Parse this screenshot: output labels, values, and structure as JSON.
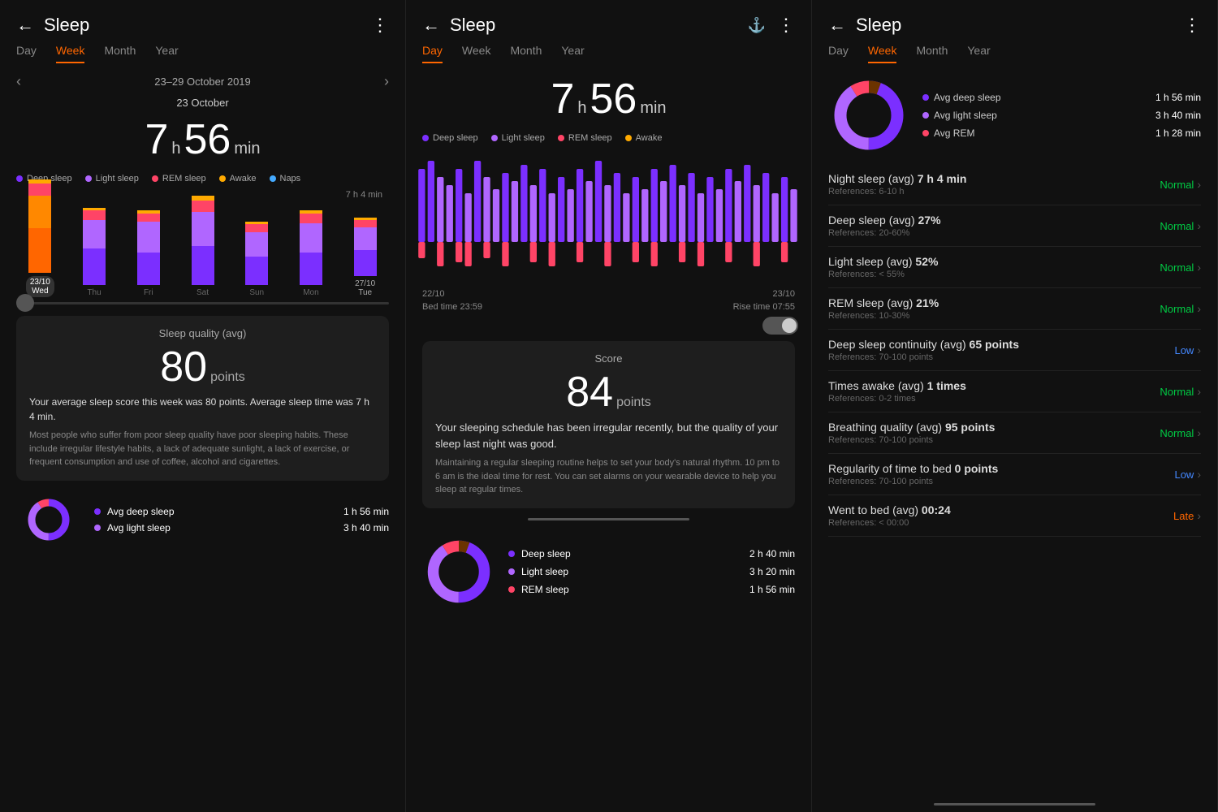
{
  "panel1": {
    "title": "Sleep",
    "tabs": [
      "Day",
      "Week",
      "Month",
      "Year"
    ],
    "active_tab": "Week",
    "nav_date": "23–29 October 2019",
    "sub_date": "23 October",
    "sleep_h": "7",
    "sleep_min": "56",
    "legend": [
      {
        "label": "Deep sleep",
        "color": "#7b2fff"
      },
      {
        "label": "Light sleep",
        "color": "#b066ff"
      },
      {
        "label": "REM sleep",
        "color": "#ff4466"
      },
      {
        "label": "Awake",
        "color": "#ffaa00"
      },
      {
        "label": "Naps",
        "color": "#44aaff"
      }
    ],
    "bar_avg_label": "7 h 4 min",
    "bars": [
      {
        "day": "23/10",
        "sub": "Wed",
        "active": true,
        "deep": 60,
        "light": 40,
        "rem": 15,
        "awake": 5
      },
      {
        "day": "Thu",
        "sub": "",
        "active": false,
        "deep": 40,
        "light": 35,
        "rem": 12,
        "awake": 3
      },
      {
        "day": "Fri",
        "sub": "",
        "active": false,
        "deep": 35,
        "light": 38,
        "rem": 10,
        "awake": 4
      },
      {
        "day": "Sat",
        "sub": "",
        "active": false,
        "deep": 45,
        "light": 42,
        "rem": 14,
        "awake": 6
      },
      {
        "day": "Sun",
        "sub": "",
        "active": false,
        "deep": 30,
        "light": 30,
        "rem": 10,
        "awake": 3
      },
      {
        "day": "Mon",
        "sub": "",
        "active": false,
        "deep": 38,
        "light": 36,
        "rem": 12,
        "awake": 4
      },
      {
        "day": "27/10",
        "sub": "Tue",
        "active": false,
        "deep": 32,
        "light": 28,
        "rem": 9,
        "awake": 3
      }
    ],
    "score_title": "Sleep quality (avg)",
    "score": "80",
    "score_pts": "points",
    "score_desc": "Your average sleep score this week was 80 points. Average sleep time was 7 h 4 min.",
    "score_sub": "Most people who suffer from poor sleep quality have poor sleeping habits. These include irregular lifestyle habits, a lack of adequate sunlight, a lack of exercise, or frequent consumption and use of coffee, alcohol and cigarettes.",
    "donut_items": [
      {
        "label": "Avg deep sleep",
        "color": "#7b2fff",
        "value": "1 h 56 min"
      },
      {
        "label": "Avg light sleep",
        "color": "#b066ff",
        "value": "3 h 40 min"
      }
    ]
  },
  "panel2": {
    "title": "Sleep",
    "tabs": [
      "Day",
      "Week",
      "Month",
      "Year"
    ],
    "active_tab": "Day",
    "sleep_h": "7",
    "sleep_min": "56",
    "legend": [
      {
        "label": "Deep sleep",
        "color": "#7b2fff"
      },
      {
        "label": "Light sleep",
        "color": "#b066ff"
      },
      {
        "label": "REM sleep",
        "color": "#ff4466"
      },
      {
        "label": "Awake",
        "color": "#ffaa00"
      }
    ],
    "bed_date": "22/10",
    "bed_time": "Bed time 23:59",
    "rise_date": "23/10",
    "rise_time": "Rise time 07:55",
    "score_title": "Score",
    "score": "84",
    "score_pts": "points",
    "score_desc": "Your sleeping schedule has been irregular recently, but the quality of your sleep last night was good.",
    "score_sub": "Maintaining a regular sleeping routine helps to set your body's natural rhythm. 10 pm to 6 am is the ideal time for rest. You can set alarms on your wearable device to help you sleep at regular times.",
    "donut_items": [
      {
        "label": "Deep sleep",
        "color": "#7b2fff",
        "value": "2 h 40 min"
      },
      {
        "label": "Light sleep",
        "color": "#b066ff",
        "value": "3 h 20 min"
      },
      {
        "label": "REM sleep",
        "color": "#ff4466",
        "value": "1 h 56 min"
      }
    ]
  },
  "panel3": {
    "title": "Sleep",
    "tabs": [
      "Day",
      "Week",
      "Month",
      "Year"
    ],
    "active_tab": "Week",
    "donut_legend": [
      {
        "label": "Avg deep sleep",
        "color": "#7b2fff",
        "value": "1 h 56 min"
      },
      {
        "label": "Avg light sleep",
        "color": "#b066ff",
        "value": "3 h 40 min"
      },
      {
        "label": "Avg REM",
        "color": "#ff4466",
        "value": "1 h 28 min"
      }
    ],
    "stats": [
      {
        "title": "Night sleep (avg)  7 h 4 min",
        "ref": "References: 6-10 h",
        "status": "Normal",
        "type": "normal"
      },
      {
        "title": "Deep sleep (avg)  27%",
        "ref": "References: 20-60%",
        "status": "Normal",
        "type": "normal"
      },
      {
        "title": "Light sleep (avg)  52%",
        "ref": "References: < 55%",
        "status": "Normal",
        "type": "normal"
      },
      {
        "title": "REM sleep (avg)  21%",
        "ref": "References: 10-30%",
        "status": "Normal",
        "type": "normal"
      },
      {
        "title": "Deep sleep continuity (avg)  65 points",
        "ref": "References: 70-100 points",
        "status": "Low",
        "type": "low"
      },
      {
        "title": "Times awake (avg)  1 times",
        "ref": "References: 0-2 times",
        "status": "Normal",
        "type": "normal"
      },
      {
        "title": "Breathing quality (avg)  95 points",
        "ref": "References: 70-100 points",
        "status": "Normal",
        "type": "normal"
      },
      {
        "title": "Regularity of time to bed  0 points",
        "ref": "References: 70-100 points",
        "status": "Low",
        "type": "low"
      },
      {
        "title": "Went to bed (avg)  00:24",
        "ref": "References: < 00:00",
        "status": "Late",
        "type": "late"
      }
    ]
  },
  "colors": {
    "deep": "#7b2fff",
    "light": "#b066ff",
    "rem": "#ff4466",
    "awake": "#ffaa00",
    "naps": "#44aaff",
    "normal": "#00cc44",
    "low": "#4488ff",
    "late": "#ff6600",
    "accent": "#ff6600"
  }
}
